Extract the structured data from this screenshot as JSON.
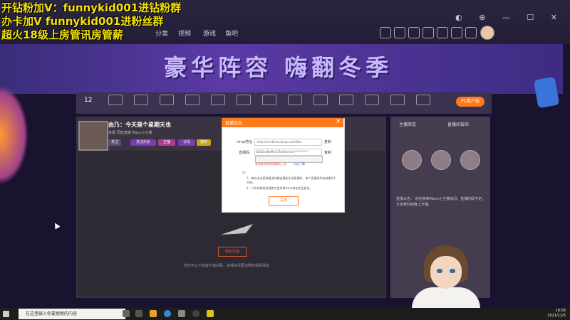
{
  "watermark": {
    "line1": "开钻粉加V：funnykid001进钻粉群",
    "line2": "办卡加V funnykid001进粉丝群",
    "line3": "超火18级上房管讯房管薪"
  },
  "nav": {
    "items": [
      "分类",
      "视频",
      "游戏",
      "鱼吧"
    ]
  },
  "banner": {
    "title": "豪华阵容 嗨翻冬季"
  },
  "toolbar": {
    "count": "12",
    "pc_button": "PC客户端"
  },
  "streamer": {
    "name": "由乃：今天是个星期天也",
    "sub": "举报  同款直播  Mayu小主播",
    "tags": [
      "关注",
      "关注乐乐",
      "主播",
      "订阅",
      "抽奖"
    ]
  },
  "video": {
    "refresh": "刷新页面",
    "hint": "您还可以下载客户端观看，获得高清更流畅的观看体验"
  },
  "modal": {
    "title": "直播信息",
    "close": "×",
    "rtmp_label": "rtmp地址:",
    "rtmp_value": "rtmp://sendtc3a.douyu.com/live",
    "code_label": "直播码:",
    "code_value": "8582vk8eMcCdTxsSecrets**********",
    "copy": "复制",
    "red_note": "若你推流失败请重新上线",
    "link": "点此了解",
    "note_head": "注：",
    "notes": [
      "1、每次点击获取推流码都会重新生成直播码，每个直播码的有效期为1分钟。",
      "2、只有切换推流线路才会导致rtmp地址发生变化。"
    ],
    "confirm": "关闭"
  },
  "right": {
    "tab1": "主播荣誉",
    "tab2": "直播间装饰",
    "announce": "直播公告：  欢迎来到Mayu小主播房间。直播时段不定，大多数时候晚上开播。"
  },
  "taskbar": {
    "search": "在这里输入你要搜索的内容",
    "time": "18:58",
    "date": "2021/12/5"
  }
}
